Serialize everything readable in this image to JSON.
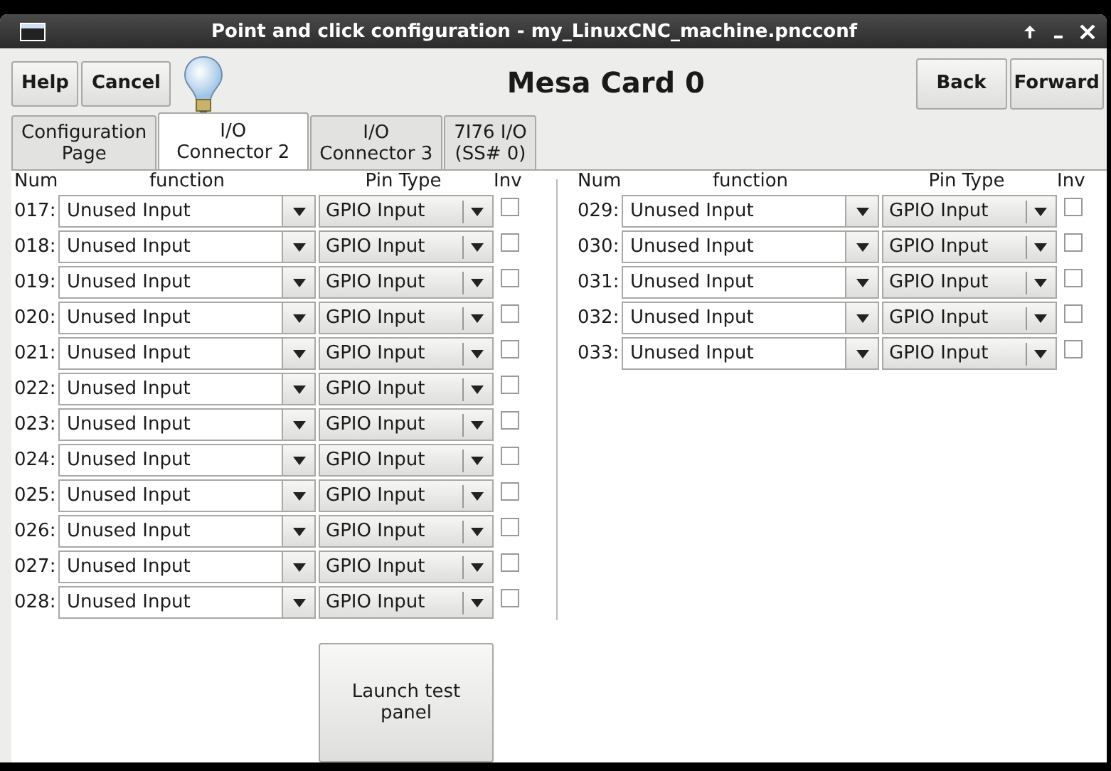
{
  "window": {
    "title": "Point and click configuration - my_LinuxCNC_machine.pncconf"
  },
  "toolbar": {
    "left_buttons": [
      "Help",
      "Cancel"
    ],
    "heading": "Mesa Card 0",
    "right_buttons": [
      "Back",
      "Forward"
    ]
  },
  "tabs": [
    {
      "label": "Configuration\nPage",
      "selected": false
    },
    {
      "label": "I/O\nConnector 2",
      "selected": true
    },
    {
      "label": "I/O\nConnector 3",
      "selected": false
    },
    {
      "label": "7I76 I/O\n(SS# 0)",
      "selected": false
    }
  ],
  "panels": [
    {
      "columns": [
        "Num",
        "function",
        "Pin Type",
        "Inv"
      ],
      "rows": [
        {
          "num": "017:",
          "function": "Unused Input",
          "pin_type": "GPIO Input",
          "inv": false
        },
        {
          "num": "018:",
          "function": "Unused Input",
          "pin_type": "GPIO Input",
          "inv": false
        },
        {
          "num": "019:",
          "function": "Unused Input",
          "pin_type": "GPIO Input",
          "inv": false
        },
        {
          "num": "020:",
          "function": "Unused Input",
          "pin_type": "GPIO Input",
          "inv": false
        },
        {
          "num": "021:",
          "function": "Unused Input",
          "pin_type": "GPIO Input",
          "inv": false
        },
        {
          "num": "022:",
          "function": "Unused Input",
          "pin_type": "GPIO Input",
          "inv": false
        },
        {
          "num": "023:",
          "function": "Unused Input",
          "pin_type": "GPIO Input",
          "inv": false
        },
        {
          "num": "024:",
          "function": "Unused Input",
          "pin_type": "GPIO Input",
          "inv": false
        },
        {
          "num": "025:",
          "function": "Unused Input",
          "pin_type": "GPIO Input",
          "inv": false
        },
        {
          "num": "026:",
          "function": "Unused Input",
          "pin_type": "GPIO Input",
          "inv": false
        },
        {
          "num": "027:",
          "function": "Unused Input",
          "pin_type": "GPIO Input",
          "inv": false
        },
        {
          "num": "028:",
          "function": "Unused Input",
          "pin_type": "GPIO Input",
          "inv": false
        }
      ]
    },
    {
      "columns": [
        "Num",
        "function",
        "Pin Type",
        "Inv"
      ],
      "rows": [
        {
          "num": "029:",
          "function": "Unused Input",
          "pin_type": "GPIO Input",
          "inv": false
        },
        {
          "num": "030:",
          "function": "Unused Input",
          "pin_type": "GPIO Input",
          "inv": false
        },
        {
          "num": "031:",
          "function": "Unused Input",
          "pin_type": "GPIO Input",
          "inv": false
        },
        {
          "num": "032:",
          "function": "Unused Input",
          "pin_type": "GPIO Input",
          "inv": false
        },
        {
          "num": "033:",
          "function": "Unused Input",
          "pin_type": "GPIO Input",
          "inv": false
        }
      ]
    }
  ],
  "launch_button": "Launch test panel"
}
